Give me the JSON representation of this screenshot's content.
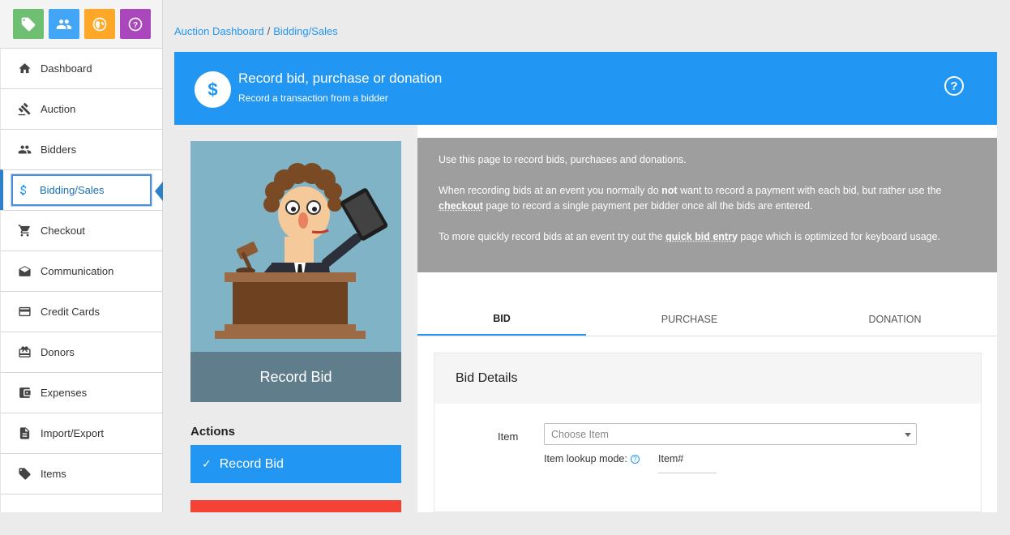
{
  "quick_buttons": [
    {
      "name": "tag-icon",
      "color": "#6fbf73"
    },
    {
      "name": "people-icon",
      "color": "#42a5f5"
    },
    {
      "name": "globe-icon",
      "color": "#ffa726"
    },
    {
      "name": "help-icon",
      "color": "#ab47bc"
    }
  ],
  "sidebar": {
    "items": [
      {
        "label": "Dashboard",
        "icon": "home-icon"
      },
      {
        "label": "Auction",
        "icon": "gavel-icon"
      },
      {
        "label": "Bidders",
        "icon": "people-icon"
      },
      {
        "label": "Bidding/Sales",
        "icon": "dollar-icon",
        "active": true
      },
      {
        "label": "Checkout",
        "icon": "cart-icon"
      },
      {
        "label": "Communication",
        "icon": "envelope-icon"
      },
      {
        "label": "Credit Cards",
        "icon": "credit-card-icon"
      },
      {
        "label": "Donors",
        "icon": "gift-icon"
      },
      {
        "label": "Expenses",
        "icon": "wallet-icon"
      },
      {
        "label": "Import/Export",
        "icon": "document-icon"
      },
      {
        "label": "Items",
        "icon": "tag-icon"
      }
    ]
  },
  "breadcrumb": {
    "root": "Auction Dashboard",
    "sep": "/",
    "current": "Bidding/Sales"
  },
  "banner": {
    "icon_glyph": "$",
    "title": "Record bid, purchase or donation",
    "subtitle": "Record a transaction from a bidder",
    "help_glyph": "?",
    "color": "#2196f3"
  },
  "card": {
    "caption": "Record Bid"
  },
  "actions": {
    "heading": "Actions",
    "primary_label": "Record Bid",
    "check_glyph": "✓"
  },
  "info": {
    "p1": "Use this page to record bids, purchases and donations.",
    "p2_a": "When recording bids at an event you normally do ",
    "p2_b": "not",
    "p2_c": " want to record a payment with each bid, but rather use the ",
    "p2_link": "checkout",
    "p2_d": " page to record a single payment per bidder once all the bids are entered.",
    "p3_a": "To more quickly record bids at an event try out the ",
    "p3_link": "quick bid entry",
    "p3_b": " page which is optimized for keyboard usage."
  },
  "tabs": [
    {
      "label": "BID",
      "active": true
    },
    {
      "label": "PURCHASE"
    },
    {
      "label": "DONATION"
    }
  ],
  "details": {
    "heading": "Bid Details",
    "item_label": "Item",
    "item_placeholder": "Choose Item",
    "lookup_label": "Item lookup mode:",
    "lookup_help_glyph": "?",
    "lookup_value": "Item#"
  }
}
